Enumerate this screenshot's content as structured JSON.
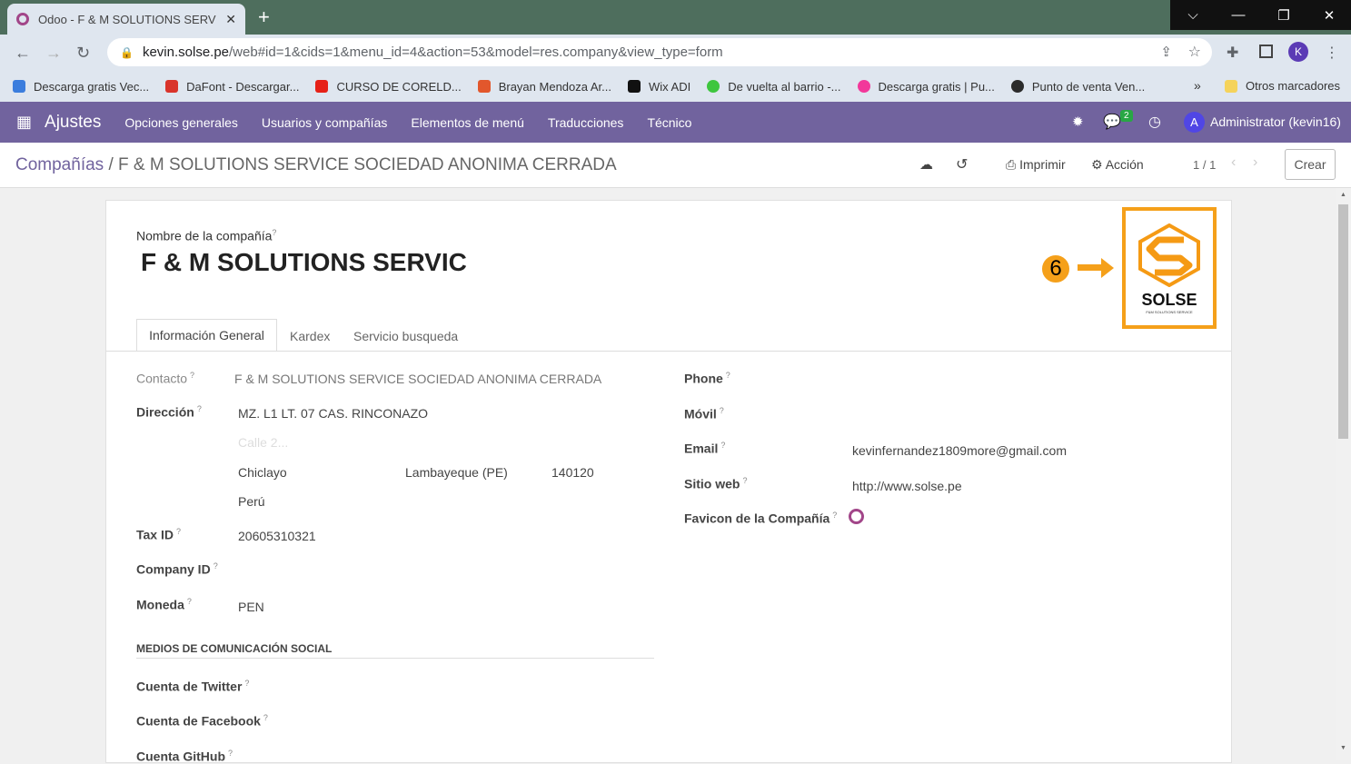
{
  "browser": {
    "tab_title": "Odoo - F & M SOLUTIONS SERV",
    "tab_close": "✕",
    "new_tab": "+",
    "url_host": "kevin.solse.pe",
    "url_path": "/web#id=1&cids=1&menu_id=4&action=53&model=res.company&view_type=form",
    "profile_initial": "K",
    "bookmarks": [
      {
        "label": "Descarga gratis Vec...",
        "color": "#3b7ddd"
      },
      {
        "label": "DaFont - Descargar...",
        "color": "#d9342b"
      },
      {
        "label": "CURSO DE CORELD...",
        "color": "#e62117"
      },
      {
        "label": "Brayan Mendoza Ar...",
        "color": "#e2572c"
      },
      {
        "label": "Wix ADI",
        "color": "#111111"
      },
      {
        "label": "De vuelta al barrio -...",
        "color": "#3ec63e"
      },
      {
        "label": "Descarga gratis | Pu...",
        "color": "#f2389a"
      },
      {
        "label": "Punto de venta Ven...",
        "color": "#2b2b2b"
      }
    ],
    "bookmarks_more": "»",
    "other_bookmarks": "Otros marcadores"
  },
  "odoo": {
    "app_name": "Ajustes",
    "menus": [
      "Opciones generales",
      "Usuarios y compañías",
      "Elementos de menú",
      "Traducciones",
      "Técnico"
    ],
    "chat_badge": "2",
    "user_initial": "A",
    "user_name": "Administrator (kevin16)"
  },
  "control": {
    "breadcrumb_parent": "Compañías",
    "breadcrumb_sep": "/",
    "breadcrumb_current": "F & M SOLUTIONS SERVICE SOCIEDAD ANONIMA CERRADA",
    "print_label": "Imprimir",
    "action_label": "Acción",
    "pager": "1 / 1",
    "create_label": "Crear"
  },
  "form": {
    "company_name_label": "Nombre de la compañía",
    "company_name": "F & M SOLUTIONS SERVIC",
    "annotation_number": "6",
    "logo_text": "SOLSE",
    "logo_subtext": "F&M SOLUTIONS SERVICE",
    "tabs": [
      "Información General",
      "Kardex",
      "Servicio busqueda"
    ],
    "contact_label": "Contacto",
    "contact_value": "F & M SOLUTIONS SERVICE SOCIEDAD ANONIMA CERRADA",
    "address_label": "Dirección",
    "street": "MZ. L1 LT. 07 CAS. RINCONAZO",
    "street2_placeholder": "Calle 2...",
    "city": "Chiclayo",
    "state": "Lambayeque (PE)",
    "zip": "140120",
    "country": "Perú",
    "taxid_label": "Tax ID",
    "taxid_value": "20605310321",
    "companyid_label": "Company ID",
    "currency_label": "Moneda",
    "currency_value": "PEN",
    "social_section": "MEDIOS DE COMUNICACIÓN SOCIAL",
    "twitter_label": "Cuenta de Twitter",
    "facebook_label": "Cuenta de Facebook",
    "github_label": "Cuenta GitHub",
    "phone_label": "Phone",
    "mobile_label": "Móvil",
    "email_label": "Email",
    "email_value": "kevinfernandez1809more@gmail.com",
    "website_label": "Sitio web",
    "website_value": "http://www.solse.pe",
    "favicon_label": "Favicon de la Compañía"
  },
  "colors": {
    "odoo_purple": "#71639e",
    "annotation_orange": "#f5a01a"
  }
}
